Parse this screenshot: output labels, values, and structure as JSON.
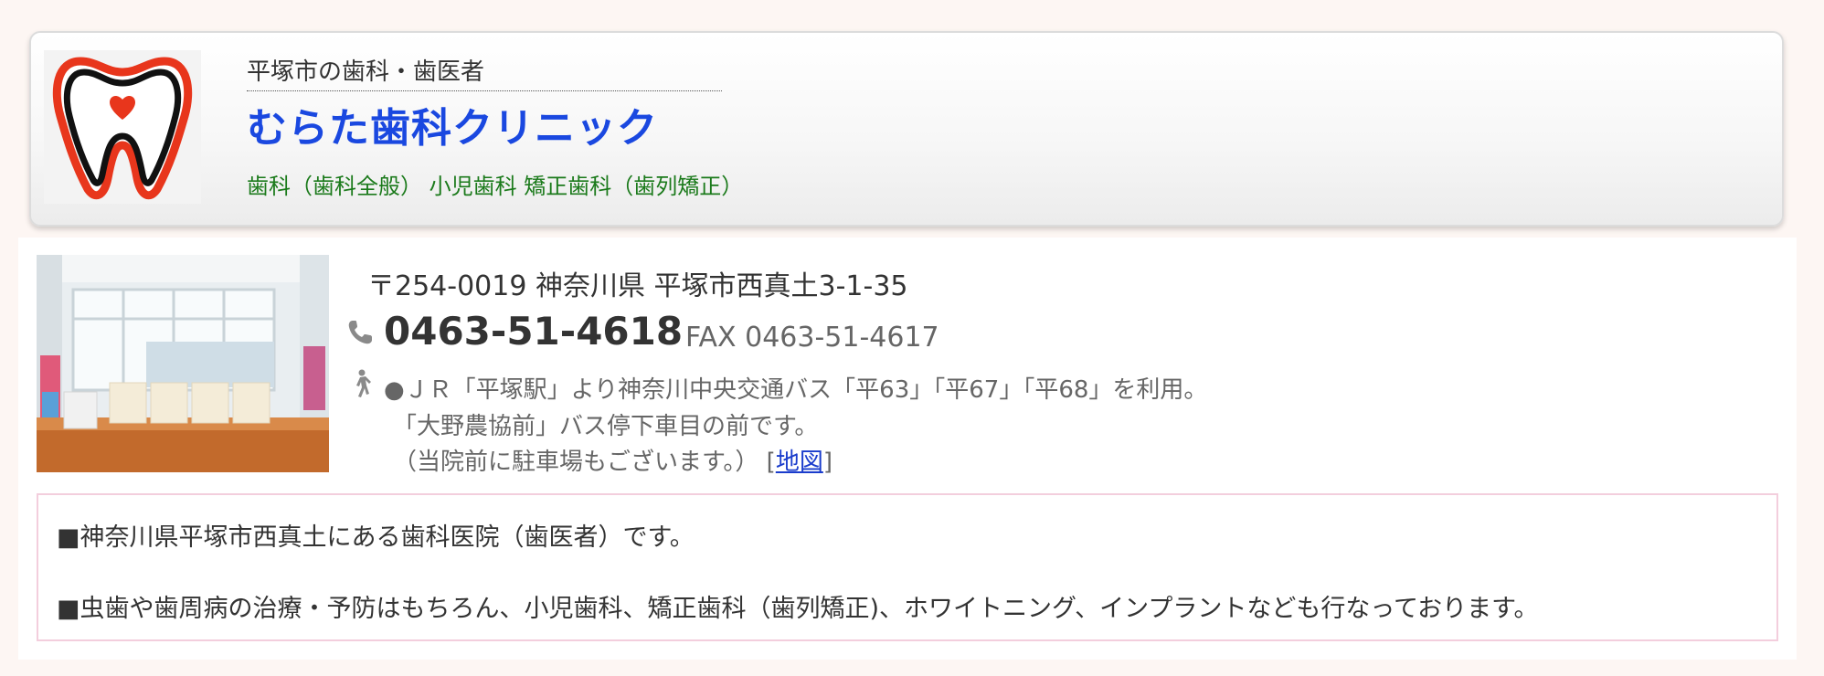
{
  "header": {
    "subtitle": "平塚市の歯科・歯医者",
    "clinic_name": "むらた歯科クリニック",
    "departments": "歯科（歯科全般）  小児歯科 矯正歯科（歯列矯正）"
  },
  "contact": {
    "address": "〒254-0019 神奈川県 平塚市西真土3-1-35",
    "phone": "0463-51-4618",
    "fax": "FAX 0463-51-4617",
    "access_line1": "●ＪＲ「平塚駅」より神奈川中央交通バス「平63」「平67」「平68」を利用。",
    "access_line2": "「大野農協前」バス停下車目の前です。",
    "access_line3_prefix": "（当院前に駐車場もございます。） [",
    "map_link": "地図",
    "access_line3_suffix": "]"
  },
  "info": {
    "line1": "■神奈川県平塚市西真土にある歯科医院（歯医者）です。",
    "line2": "■虫歯や歯周病の治療・予防はもちろん、小児歯科、矯正歯科（歯列矯正)、ホワイトニング、インプラントなども行なっております。"
  },
  "icons": {
    "logo": "tooth-logo",
    "phone": "phone-icon",
    "access": "walking-person-icon"
  },
  "colors": {
    "clinic_name": "#1a48e0",
    "departments": "#1b7a1b",
    "link": "#1a3ccc",
    "info_border": "#f3cedd"
  }
}
